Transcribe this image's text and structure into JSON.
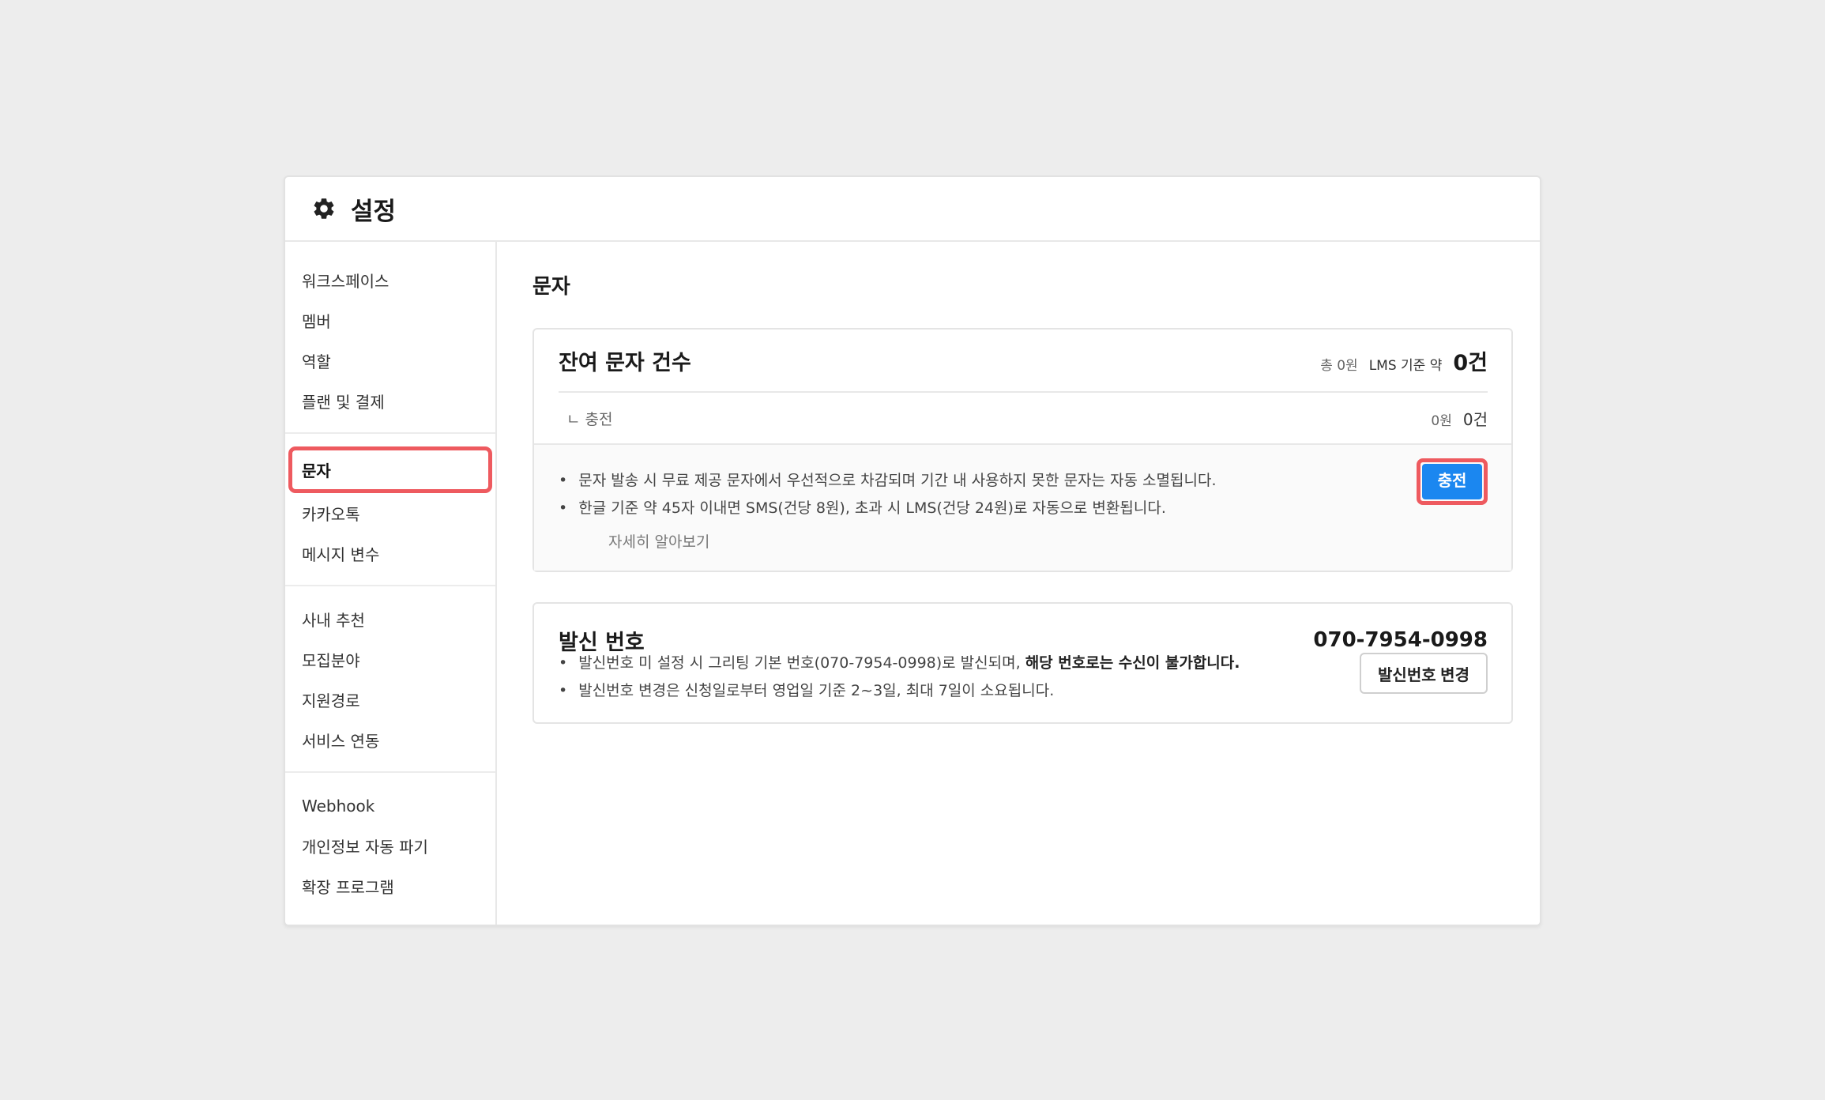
{
  "header": {
    "title": "설정",
    "icon": "gear-icon"
  },
  "sidebar": {
    "groups": [
      [
        {
          "label": "워크스페이스"
        },
        {
          "label": "멤버"
        },
        {
          "label": "역할"
        },
        {
          "label": "플랜 및 결제"
        }
      ],
      [
        {
          "label": "문자",
          "active": true
        },
        {
          "label": "카카오톡"
        },
        {
          "label": "메시지 변수"
        }
      ],
      [
        {
          "label": "사내 추천"
        },
        {
          "label": "모집분야"
        },
        {
          "label": "지원경로"
        },
        {
          "label": "서비스 연동"
        }
      ],
      [
        {
          "label": "Webhook"
        },
        {
          "label": "개인정보 자동 파기"
        },
        {
          "label": "확장 프로그램"
        }
      ]
    ]
  },
  "main": {
    "title": "문자",
    "remaining": {
      "title": "잔여 문자 건수",
      "total_label": "총 0원",
      "lms_label": "LMS 기준 약",
      "total_count": "0건",
      "sub_label": "ㄴ 충전",
      "sub_amount": "0원",
      "sub_count": "0건",
      "notes": [
        "문자 발송 시 무료 제공 문자에서 우선적으로 차감되며 기간 내 사용하지 못한 문자는 자동 소멸됩니다.",
        "한글 기준 약 45자 이내면 SMS(건당 8원), 초과 시 LMS(건당 24원)로 자동으로 변환됩니다."
      ],
      "learn_more": "자세히 알아보기",
      "charge_button": "충전"
    },
    "sender": {
      "title": "발신 번호",
      "number": "070-7954-0998",
      "note1_prefix": "발신번호 미 설정 시 그리팅 기본 번호(070-7954-0998)로 발신되며, ",
      "note1_bold": "해당 번호로는 수신이 불가합니다.",
      "note2": "발신번호 변경은 신청일로부터 영업일 기준 2~3일, 최대 7일이 소요됩니다.",
      "change_button": "발신번호 변경"
    }
  },
  "colors": {
    "accent": "#1b87f0",
    "highlight": "#ee5a5f"
  }
}
